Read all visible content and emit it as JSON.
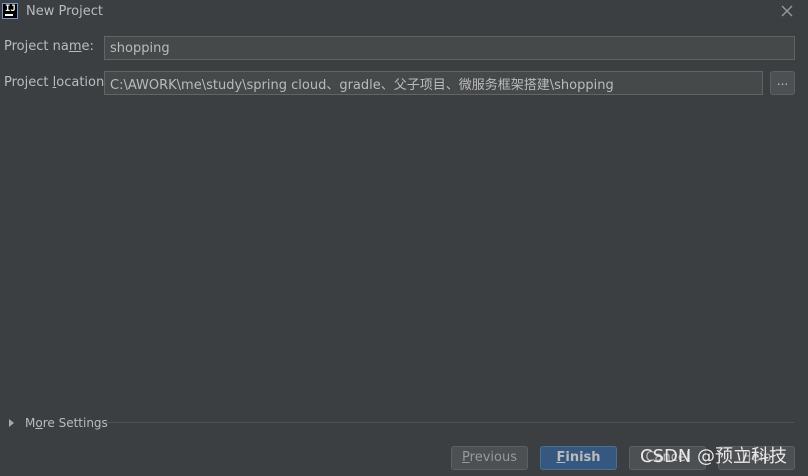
{
  "window": {
    "title": "New Project",
    "app_icon_text": "IJ"
  },
  "form": {
    "name_label_prefix": "Project na",
    "name_label_mnemonic": "m",
    "name_label_suffix": "e:",
    "name_value": "shopping",
    "location_label_prefix": "Project ",
    "location_label_mnemonic": "l",
    "location_label_suffix": "ocation:",
    "location_value": "C:\\AWORK\\me\\study\\spring cloud、gradle、父子项目、微服务框架搭建\\shopping",
    "browse_label": "..."
  },
  "more_settings": {
    "label_prefix": "M",
    "label_mnemonic": "o",
    "label_suffix": "re Settings"
  },
  "buttons": {
    "previous_mnemonic": "P",
    "previous_rest": "revious",
    "finish_mnemonic": "F",
    "finish_rest": "inish",
    "cancel_label": "Cancel",
    "help_label": "Help"
  },
  "watermark": "CSDN @预立科技",
  "colors": {
    "background": "#3c3f41",
    "field_background": "#45494a",
    "primary_button": "#365880",
    "text": "#bbbbbb"
  },
  "icons": {
    "app": "intellij-icon",
    "close": "close-icon",
    "expand": "triangle-right-icon"
  }
}
